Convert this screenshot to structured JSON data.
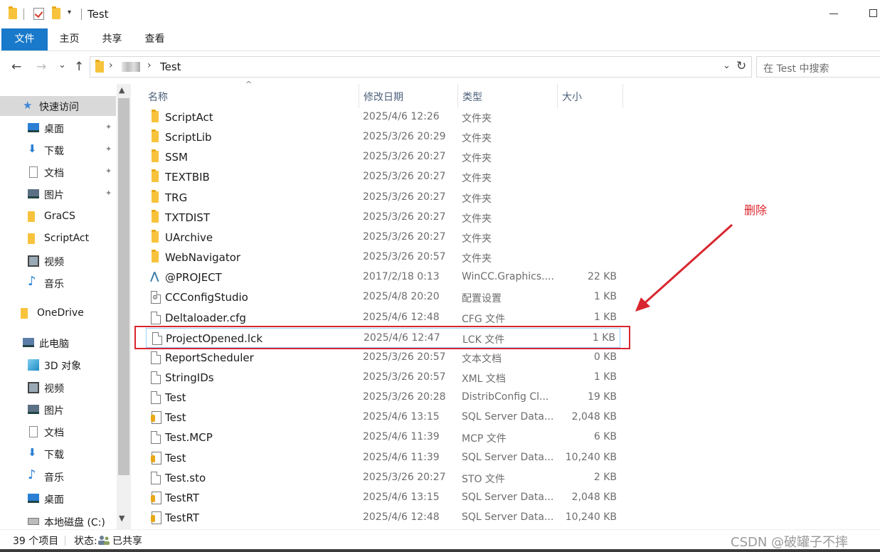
{
  "titlebar": {
    "title": "Test",
    "dropdown_glyph": "▾",
    "minimize_icon": "minimize-icon",
    "maximize_icon": "maximize-icon"
  },
  "ribbon": {
    "tabs": [
      "文件",
      "主页",
      "共享",
      "查看"
    ],
    "active_color": "#1979ca"
  },
  "nav": {
    "back": "←",
    "forward": "→",
    "recent": "⌄",
    "up": "↑",
    "path_separator": "›",
    "path_current": "Test",
    "address_dropdown": "⌄",
    "refresh": "↻",
    "search_placeholder": "在 Test 中搜索"
  },
  "sidebar": {
    "items": [
      {
        "label": "快速访问",
        "icon": "star-icon",
        "pinned": false
      },
      {
        "label": "桌面",
        "icon": "desktop-icon",
        "pinned": true
      },
      {
        "label": "下载",
        "icon": "download-icon",
        "pinned": true
      },
      {
        "label": "文档",
        "icon": "document-icon",
        "pinned": true
      },
      {
        "label": "图片",
        "icon": "picture-icon",
        "pinned": true
      },
      {
        "label": "GraCS",
        "icon": "folder-icon",
        "pinned": false
      },
      {
        "label": "ScriptAct",
        "icon": "folder-icon",
        "pinned": false
      },
      {
        "label": "视频",
        "icon": "video-icon",
        "pinned": false
      },
      {
        "label": "音乐",
        "icon": "music-icon",
        "pinned": false
      },
      {
        "label": "OneDrive",
        "icon": "folder-icon",
        "pinned": false
      },
      {
        "label": "此电脑",
        "icon": "computer-icon",
        "pinned": false
      },
      {
        "label": "3D 对象",
        "icon": "cube-icon",
        "pinned": false
      },
      {
        "label": "视频",
        "icon": "video-icon",
        "pinned": false
      },
      {
        "label": "图片",
        "icon": "picture-icon",
        "pinned": false
      },
      {
        "label": "文档",
        "icon": "document-icon",
        "pinned": false
      },
      {
        "label": "下载",
        "icon": "download-icon",
        "pinned": false
      },
      {
        "label": "音乐",
        "icon": "music-icon",
        "pinned": false
      },
      {
        "label": "桌面",
        "icon": "desktop-icon",
        "pinned": false
      },
      {
        "label": "本地磁盘 (C:)",
        "icon": "drive-icon",
        "pinned": false
      }
    ],
    "pin_glyph": "📌",
    "scroll_up": "▲",
    "scroll_down": "▼"
  },
  "columns": {
    "name": "名称",
    "date": "修改日期",
    "type": "类型",
    "size": "大小",
    "sort_glyph": "^"
  },
  "files": [
    {
      "name": "ScriptAct",
      "date": "2025/4/6 12:26",
      "type": "文件夹",
      "size": "",
      "icon": "folder-icon"
    },
    {
      "name": "ScriptLib",
      "date": "2025/3/26 20:29",
      "type": "文件夹",
      "size": "",
      "icon": "folder-icon"
    },
    {
      "name": "SSM",
      "date": "2025/3/26 20:27",
      "type": "文件夹",
      "size": "",
      "icon": "folder-icon"
    },
    {
      "name": "TEXTBIB",
      "date": "2025/3/26 20:27",
      "type": "文件夹",
      "size": "",
      "icon": "folder-icon"
    },
    {
      "name": "TRG",
      "date": "2025/3/26 20:27",
      "type": "文件夹",
      "size": "",
      "icon": "folder-icon"
    },
    {
      "name": "TXTDIST",
      "date": "2025/3/26 20:27",
      "type": "文件夹",
      "size": "",
      "icon": "folder-icon"
    },
    {
      "name": "UArchive",
      "date": "2025/3/26 20:27",
      "type": "文件夹",
      "size": "",
      "icon": "folder-icon"
    },
    {
      "name": "WebNavigator",
      "date": "2025/3/26 20:57",
      "type": "文件夹",
      "size": "",
      "icon": "folder-icon"
    },
    {
      "name": "@PROJECT",
      "date": "2017/2/18 0:13",
      "type": "WinCC.Graphics....",
      "size": "22 KB",
      "icon": "wincc-icon"
    },
    {
      "name": "CCConfigStudio",
      "date": "2025/4/8 20:20",
      "type": "配置设置",
      "size": "1 KB",
      "icon": "config-icon"
    },
    {
      "name": "Deltaloader.cfg",
      "date": "2025/4/6 12:48",
      "type": "CFG 文件",
      "size": "1 KB",
      "icon": "file-icon"
    },
    {
      "name": "ProjectOpened.lck",
      "date": "2025/4/6 12:47",
      "type": "LCK 文件",
      "size": "1 KB",
      "icon": "file-icon"
    },
    {
      "name": "ReportScheduler",
      "date": "2025/3/26 20:57",
      "type": "文本文档",
      "size": "0 KB",
      "icon": "file-icon"
    },
    {
      "name": "StringIDs",
      "date": "2025/3/26 20:57",
      "type": "XML 文档",
      "size": "1 KB",
      "icon": "file-icon"
    },
    {
      "name": "Test",
      "date": "2025/3/26 20:28",
      "type": "DistribConfig Cl...",
      "size": "19 KB",
      "icon": "file-icon"
    },
    {
      "name": "Test",
      "date": "2025/4/6 13:15",
      "type": "SQL Server Data...",
      "size": "2,048 KB",
      "icon": "database-icon"
    },
    {
      "name": "Test.MCP",
      "date": "2025/4/6 11:39",
      "type": "MCP 文件",
      "size": "6 KB",
      "icon": "file-icon"
    },
    {
      "name": "Test",
      "date": "2025/4/6 11:39",
      "type": "SQL Server Data...",
      "size": "10,240 KB",
      "icon": "database-icon"
    },
    {
      "name": "Test.sto",
      "date": "2025/3/26 20:27",
      "type": "STO 文件",
      "size": "2 KB",
      "icon": "file-icon"
    },
    {
      "name": "TestRT",
      "date": "2025/4/6 13:15",
      "type": "SQL Server Data...",
      "size": "2,048 KB",
      "icon": "database-icon"
    },
    {
      "name": "TestRT",
      "date": "2025/4/6 12:48",
      "type": "SQL Server Data...",
      "size": "10,240 KB",
      "icon": "database-icon"
    }
  ],
  "annotation": {
    "text": "删除",
    "color": "#d9262e"
  },
  "status": {
    "count": "39 个项目",
    "state_label": "状态:",
    "share_label": "已共享"
  },
  "watermark": "CSDN @破罐子不摔"
}
